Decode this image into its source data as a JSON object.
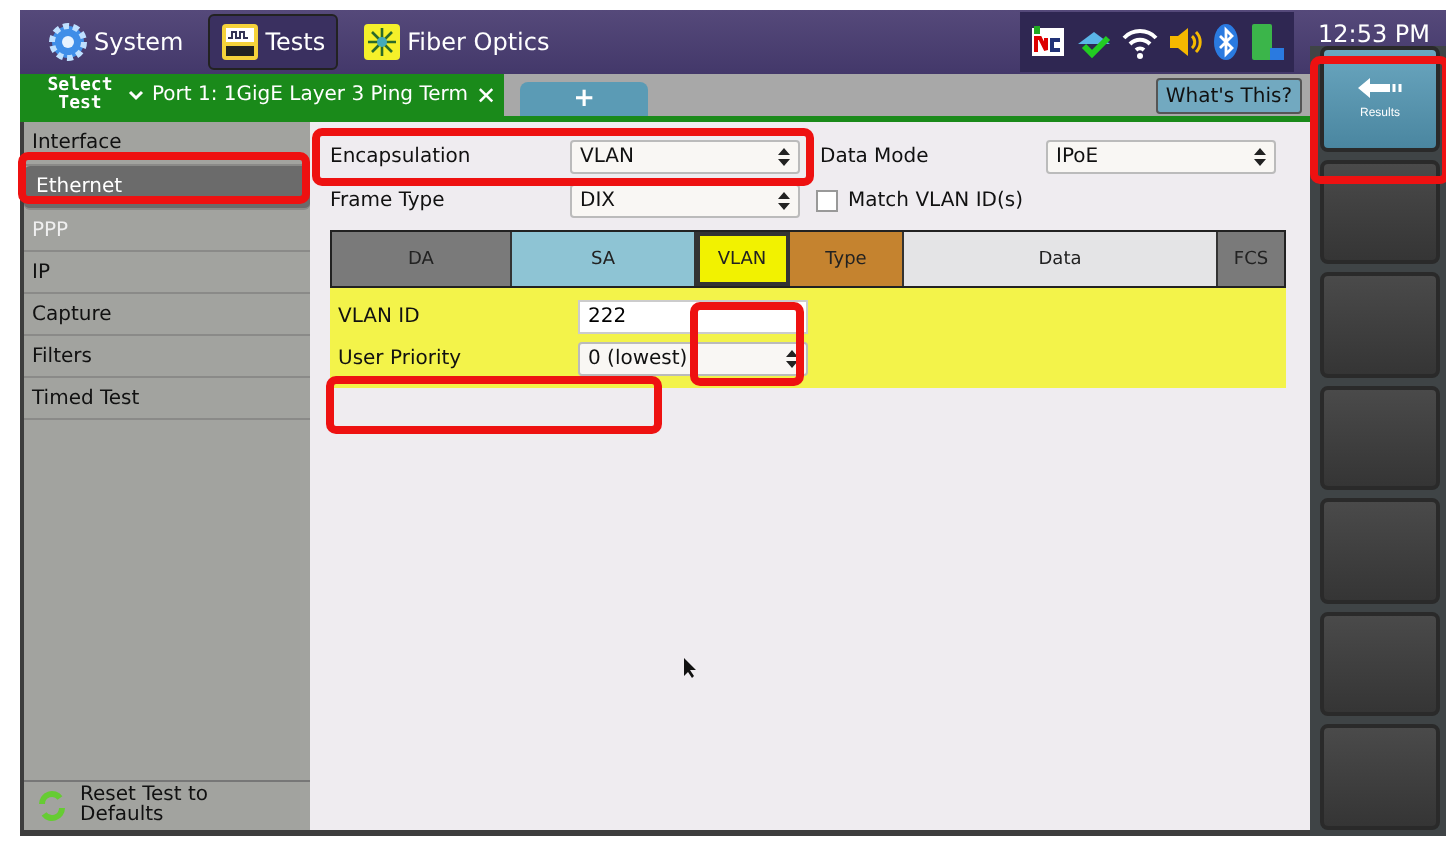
{
  "top_bar": {
    "tabs": [
      {
        "label": "System",
        "selected": false
      },
      {
        "label": "Tests",
        "selected": true
      },
      {
        "label": "Fiber Optics",
        "selected": false
      }
    ],
    "time": "12:53 PM"
  },
  "test_tabs": {
    "select_label": "Select Test",
    "tabs": [
      {
        "label": "Port 1: 1GigE Layer 3 Ping Term",
        "close": "✕"
      }
    ],
    "add": "+",
    "help": "What's This?"
  },
  "sidebar": {
    "items": [
      {
        "label": "Interface",
        "selected": false,
        "disabled": false
      },
      {
        "label": "Ethernet",
        "selected": true,
        "disabled": false
      },
      {
        "label": "PPP",
        "selected": false,
        "disabled": true
      },
      {
        "label": "IP",
        "selected": false,
        "disabled": false
      },
      {
        "label": "Capture",
        "selected": false,
        "disabled": false
      },
      {
        "label": "Filters",
        "selected": false,
        "disabled": false
      },
      {
        "label": "Timed Test",
        "selected": false,
        "disabled": false
      }
    ],
    "reset": "Reset Test to Defaults"
  },
  "form": {
    "encapsulation": {
      "label": "Encapsulation",
      "value": "VLAN"
    },
    "data_mode": {
      "label": "Data Mode",
      "value": "IPoE"
    },
    "frame_type": {
      "label": "Frame Type",
      "value": "DIX"
    },
    "match_vlan": {
      "label": "Match VLAN ID(s)",
      "checked": false
    }
  },
  "frame": [
    {
      "label": "DA",
      "color": "#7a7a7a",
      "selected": false
    },
    {
      "label": "SA",
      "color": "#8ec4d4",
      "selected": false
    },
    {
      "label": "VLAN",
      "color": "#f2f200",
      "selected": true
    },
    {
      "label": "Type",
      "color": "#c5832f",
      "selected": false
    },
    {
      "label": "Data",
      "color": "#e4e4e6",
      "selected": false
    },
    {
      "label": "FCS",
      "color": "#7a7a7a",
      "selected": false
    }
  ],
  "vlan": {
    "id_label": "VLAN ID",
    "id_value": "222",
    "priority_label": "User Priority",
    "priority_value": "0 (lowest)"
  },
  "side_buttons": [
    {
      "label": "Results",
      "kind": "results"
    },
    {
      "kind": "blank"
    },
    {
      "kind": "blank"
    },
    {
      "kind": "blank"
    },
    {
      "kind": "blank"
    },
    {
      "kind": "blank"
    },
    {
      "kind": "blank"
    }
  ]
}
